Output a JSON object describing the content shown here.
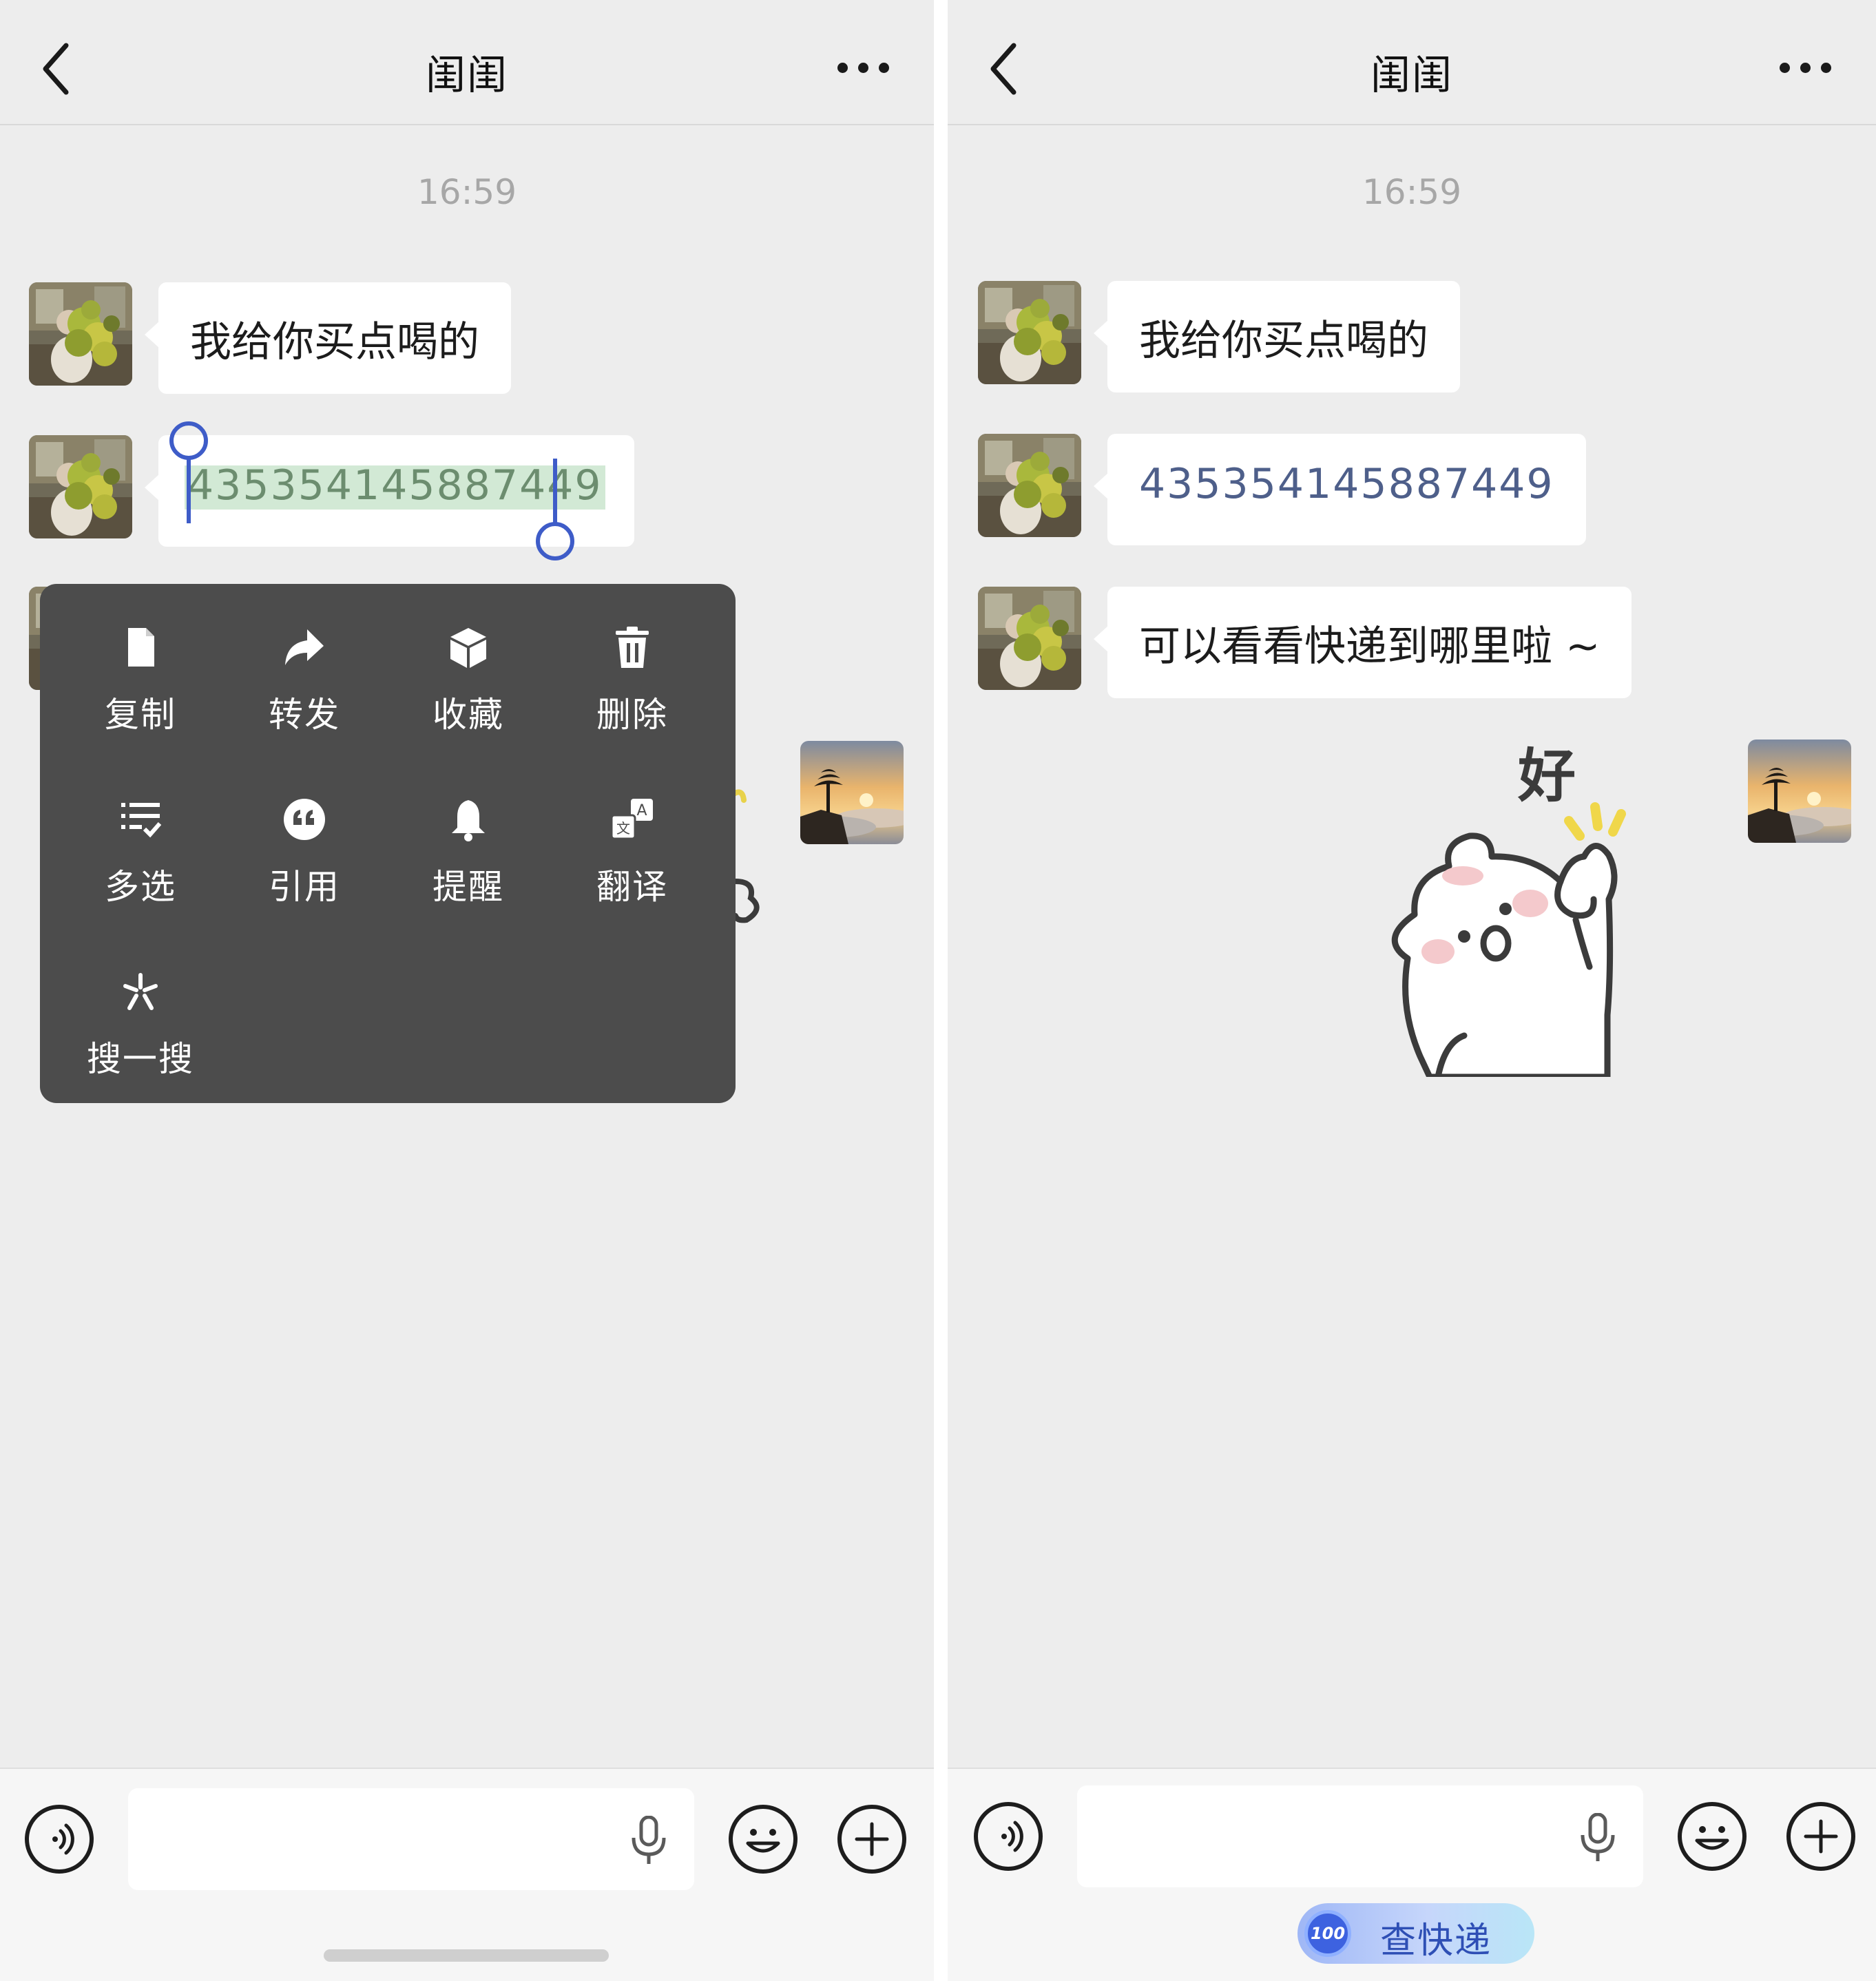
{
  "left_screen": {
    "header": {
      "title": "闺闺"
    },
    "timestamp": "16:59",
    "messages": [
      {
        "text": "我给你买点喝的"
      },
      {
        "text": "435354145887449",
        "selected": true
      }
    ],
    "context_menu": {
      "items": [
        {
          "label": "复制",
          "icon": "copy-icon"
        },
        {
          "label": "转发",
          "icon": "forward-icon"
        },
        {
          "label": "收藏",
          "icon": "favorite-icon"
        },
        {
          "label": "删除",
          "icon": "delete-icon"
        },
        {
          "label": "多选",
          "icon": "multiselect-icon"
        },
        {
          "label": "引用",
          "icon": "quote-icon"
        },
        {
          "label": "提醒",
          "icon": "bell-icon"
        },
        {
          "label": "翻译",
          "icon": "translate-icon"
        },
        {
          "label": "搜一搜",
          "icon": "search-spark-icon"
        }
      ]
    }
  },
  "right_screen": {
    "header": {
      "title": "闺闺"
    },
    "timestamp": "16:59",
    "messages": [
      {
        "text": "我给你买点喝的"
      },
      {
        "text": "435354145887449"
      },
      {
        "text": "可以看看快递到哪里啦 ~"
      }
    ],
    "sticker": {
      "text": "好"
    },
    "express_button": {
      "label": "查快递",
      "logo": "100"
    }
  },
  "colors": {
    "chat_bg": "#ededed",
    "bubble_bg": "#ffffff",
    "menu_bg": "#4c4c4c",
    "selection_handle": "#3e5cc8",
    "selection_highlight": "#d2e9d5",
    "number_text": "#4e5f8a"
  }
}
